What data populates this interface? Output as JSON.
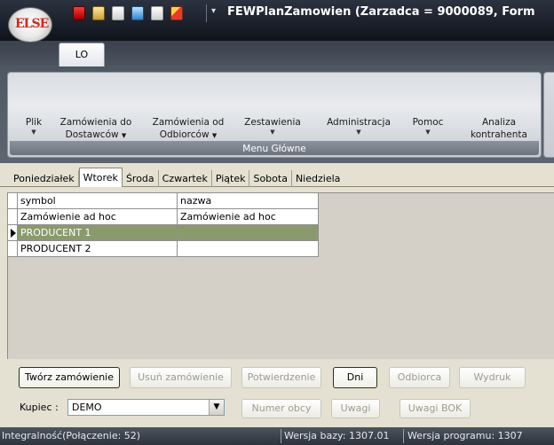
{
  "app": {
    "logo_text": "ELSE",
    "title": "FEWPlanZamowien (Zarzadca = 9000089, Form",
    "ribbon_tab": "LO"
  },
  "ribbon": {
    "group_label": "Menu Główne",
    "buttons": [
      {
        "line1": "Plik",
        "line2": "",
        "has_arrow": true
      },
      {
        "line1": "Zamówienia do",
        "line2": "Dostawców",
        "has_arrow": true
      },
      {
        "line1": "Zamówienia od",
        "line2": "Odbiorców",
        "has_arrow": true
      },
      {
        "line1": "Zestawienia",
        "line2": "",
        "has_arrow": true
      },
      {
        "line1": "Administracja",
        "line2": "",
        "has_arrow": true
      },
      {
        "line1": "Pomoc",
        "line2": "",
        "has_arrow": true
      },
      {
        "line1": "Analiza",
        "line2": "kontrahenta",
        "has_arrow": false
      }
    ]
  },
  "days": {
    "items": [
      "Poniedziałek",
      "Wtorek",
      "Środa",
      "Czwartek",
      "Piątek",
      "Sobota",
      "Niedziela"
    ],
    "active": "Wtorek"
  },
  "grid": {
    "columns": [
      "symbol",
      "nazwa"
    ],
    "rows": [
      {
        "symbol": "Zamówienie ad hoc",
        "nazwa": "Zamówienie ad hoc",
        "selected": false
      },
      {
        "symbol": "PRODUCENT 1",
        "nazwa": "",
        "selected": true
      },
      {
        "symbol": "PRODUCENT 2",
        "nazwa": "",
        "selected": false
      }
    ]
  },
  "buttons": {
    "tworz": "Twórz zamówienie",
    "usun": "Usuń zamówienie",
    "potwierdzenie": "Potwierdzenie",
    "dni": "Dni",
    "odbiorca": "Odbiorca",
    "wydruk": "Wydruk",
    "numer_obcy": "Numer obcy",
    "uwagi": "Uwagi",
    "uwagi_bok": "Uwagi BOK"
  },
  "kupiec": {
    "label": "Kupiec :",
    "value": "DEMO"
  },
  "status": {
    "integralnosc": "Integralność(Połączenie: 52)",
    "wersja_bazy": "Wersja bazy: 1307.01",
    "wersja_programu": "Wersja programu: 1307"
  },
  "colors": {
    "selected_row": "#8b9a6d",
    "titlebar": "#1b2028",
    "logo_red": "#cf2a1c"
  },
  "icons": [
    "app-logo",
    "red-save-icon",
    "document-icon",
    "edit-icon",
    "copy-icon",
    "report-icon",
    "quick-access-dropdown-icon"
  ]
}
